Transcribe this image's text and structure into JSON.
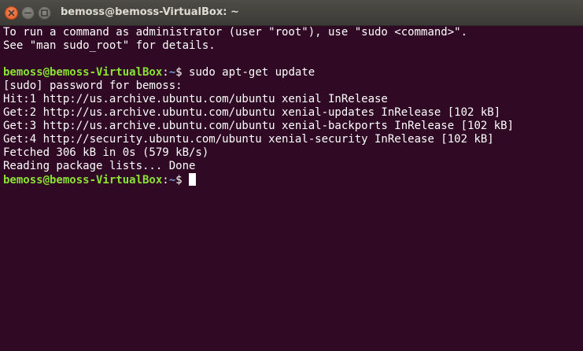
{
  "window": {
    "title": "bemoss@bemoss-VirtualBox: ~"
  },
  "terminal": {
    "prompt": {
      "user_host": "bemoss@bemoss-VirtualBox",
      "colon": ":",
      "path": "~",
      "symbol": "$ "
    },
    "lines": [
      "To run a command as administrator (user \"root\"), use \"sudo <command>\".",
      "See \"man sudo_root\" for details.",
      "",
      "sudo apt-get update",
      "[sudo] password for bemoss:",
      "Hit:1 http://us.archive.ubuntu.com/ubuntu xenial InRelease",
      "Get:2 http://us.archive.ubuntu.com/ubuntu xenial-updates InRelease [102 kB]",
      "Get:3 http://us.archive.ubuntu.com/ubuntu xenial-backports InRelease [102 kB]",
      "Get:4 http://security.ubuntu.com/ubuntu xenial-security InRelease [102 kB]",
      "Fetched 306 kB in 0s (579 kB/s)",
      "Reading package lists... Done",
      ""
    ]
  },
  "colors": {
    "background": "#300a24",
    "prompt_user": "#8ae234",
    "prompt_path": "#729fcf",
    "text": "#ffffff",
    "close_button": "#e3571d"
  },
  "icons": {
    "close": "close-icon",
    "minimize": "minimize-icon",
    "maximize": "maximize-icon"
  }
}
